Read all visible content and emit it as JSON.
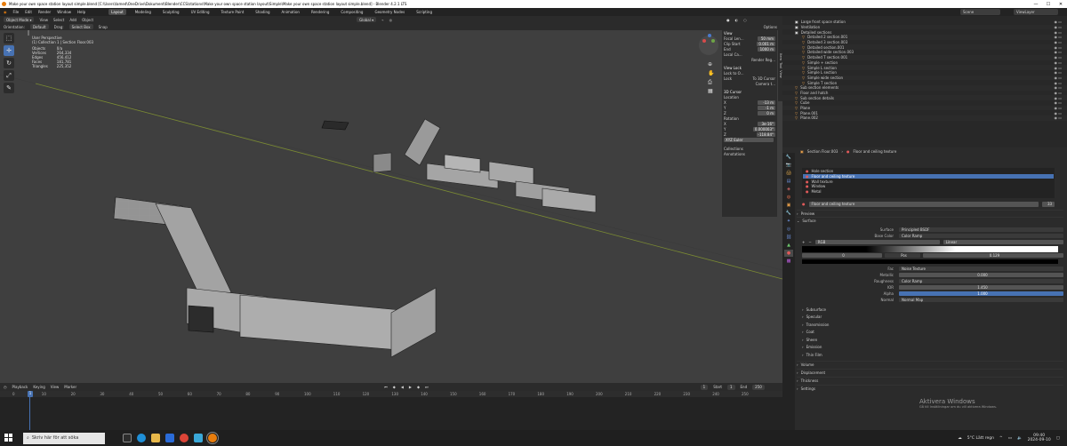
{
  "window": {
    "title": "Make your own space station layout simple.blend [C:\\Users\\lamed\\OneDrive\\Dokument\\Blender\\CCS\\stations\\Make your own space station layout\\Simple\\Make your own space station layout simple.blend] - Blender 4.2.1 LTS",
    "minimize": "—",
    "maximize": "☐",
    "close": "✕"
  },
  "menu": {
    "items": [
      "File",
      "Edit",
      "Render",
      "Window",
      "Help"
    ],
    "workspaces": [
      "Layout",
      "Modeling",
      "Sculpting",
      "UV Editing",
      "Texture Paint",
      "Shading",
      "Animation",
      "Rendering",
      "Compositing",
      "Geometry Nodes",
      "Scripting"
    ],
    "active_workspace": "Layout",
    "scene_label": "Scene",
    "view_layer_label": "ViewLayer"
  },
  "viewport_header": {
    "mode": "Object Mode",
    "menus": [
      "View",
      "Select",
      "Add",
      "Object"
    ],
    "transform_label": "Global",
    "orientation": "Orientation:",
    "orientation_value": "Default",
    "drag": "Drag:",
    "drag_value": "Select Box",
    "snap": "Snap",
    "options": "Options"
  },
  "overlay": {
    "view_name": "User Perspective",
    "collection_line": "(1) Collection 1 | Section Floor.003",
    "stats_labels": [
      "Objects",
      "Vertices",
      "Edges",
      "Faces",
      "Triangles"
    ],
    "stats_values": [
      "0/a",
      "264,334",
      "456,412",
      "181,781",
      "225,352"
    ]
  },
  "npanel": {
    "view_header": "View",
    "focal_length_label": "Focal Len...",
    "focal_length": "50 mm",
    "clip_start_label": "Clip Start",
    "clip_start": "0.001 m",
    "clip_end_label": "End",
    "clip_end": "1000 m",
    "local_camera_label": "Local Ca...",
    "render_region_label": "Render Reg...",
    "view_lock_header": "View Lock",
    "lock_to_object_label": "Lock to O...",
    "lock_label": "Lock",
    "lock_to_3d_cursor": "To 3D Cursor",
    "camera_to_view": "Camera t...",
    "cursor_header": "3D Cursor",
    "location_label": "Location",
    "location": [
      "-13 m",
      "-1 m",
      "0 m"
    ],
    "rotation_label": "Rotation",
    "rotation": [
      "3e-16°",
      "0.000003°",
      "-118.84°"
    ],
    "rotation_mode": "XYZ Euler",
    "axis_labels": [
      "X",
      "Y",
      "Z"
    ],
    "collections_header": "Collections",
    "annotations_header": "Annotations",
    "tabs": [
      "Item",
      "Tool",
      "View"
    ]
  },
  "timeline": {
    "menus": [
      "Playback",
      "Keying",
      "View",
      "Marker"
    ],
    "current_frame": "1",
    "start_label": "Start",
    "start": "1",
    "end_label": "End",
    "end": "250",
    "ticks": [
      "0",
      "10",
      "20",
      "30",
      "40",
      "50",
      "60",
      "70",
      "80",
      "90",
      "100",
      "110",
      "120",
      "130",
      "140",
      "150",
      "160",
      "170",
      "180",
      "190",
      "200",
      "210",
      "220",
      "230",
      "240",
      "250"
    ]
  },
  "outliner": {
    "items": [
      {
        "name": "Large front space station",
        "depth": 1
      },
      {
        "name": "Ventilation",
        "depth": 1
      },
      {
        "name": "Detailed sections",
        "depth": 1
      },
      {
        "name": "Detailed 2 section.001",
        "depth": 2
      },
      {
        "name": "Detailed 3 section.003",
        "depth": 2
      },
      {
        "name": "Detailed section.001",
        "depth": 2
      },
      {
        "name": "Detailed wide section.003",
        "depth": 2
      },
      {
        "name": "Detailed T section.001",
        "depth": 2
      },
      {
        "name": "Simple + section",
        "depth": 2
      },
      {
        "name": "Simple L section",
        "depth": 2
      },
      {
        "name": "Simple L section",
        "depth": 2
      },
      {
        "name": "Simple wide section",
        "depth": 2
      },
      {
        "name": "Simple T section",
        "depth": 2
      },
      {
        "name": "Sub section elements",
        "depth": 1
      },
      {
        "name": "Floor and hatch",
        "depth": 1
      },
      {
        "name": "Sub section details",
        "depth": 1
      },
      {
        "name": "Cube",
        "depth": 1
      },
      {
        "name": "Plane",
        "depth": 1
      },
      {
        "name": "Plane.001",
        "depth": 1
      },
      {
        "name": "Plane.002",
        "depth": 1
      }
    ]
  },
  "properties": {
    "breadcrumb_object": "Section Floor.003",
    "breadcrumb_material": "Floor and ceiling texture",
    "material_slots": [
      "Hole section",
      "Floor and ceiling texture",
      "Wall texture",
      "Window",
      "Metal"
    ],
    "active_slot": "Floor and ceiling texture",
    "material_name": "Floor and ceiling texture",
    "user_count": "33",
    "preview_label": "Preview",
    "surface_header": "Surface",
    "surface_label": "Surface",
    "surface_value": "Principled BSDF",
    "base_color_label": "Base Color",
    "base_color_value": "Color Ramp",
    "ramp_mode": "RGB",
    "ramp_interp": "Linear",
    "ramp_index": "0",
    "ramp_pos_label": "Pos",
    "ramp_pos": "0.129",
    "fac_label": "Fac",
    "fac_value": "Noise Texture",
    "metallic_label": "Metallic",
    "metallic": "0.000",
    "roughness_label": "Roughness",
    "roughness_value": "Color Ramp",
    "ior_label": "IOR",
    "ior": "1.450",
    "alpha_label": "Alpha",
    "alpha": "1.000",
    "normal_label": "Normal",
    "normal_value": "Normal Map",
    "subsections": [
      "Subsurface",
      "Specular",
      "Transmission",
      "Coat",
      "Sheen",
      "Emission",
      "Thin Film"
    ],
    "bottom_sections": [
      "Volume",
      "Displacement",
      "Thickness",
      "Settings"
    ]
  },
  "watermark": {
    "line1": "Aktivera Windows",
    "line2": "Gå till Inställningar om du vill aktivera Windows."
  },
  "taskbar": {
    "search_placeholder": "Skriv här för att söka",
    "weather": "5°C  Lätt regn",
    "time": "09:40",
    "date": "2024-09-10"
  }
}
